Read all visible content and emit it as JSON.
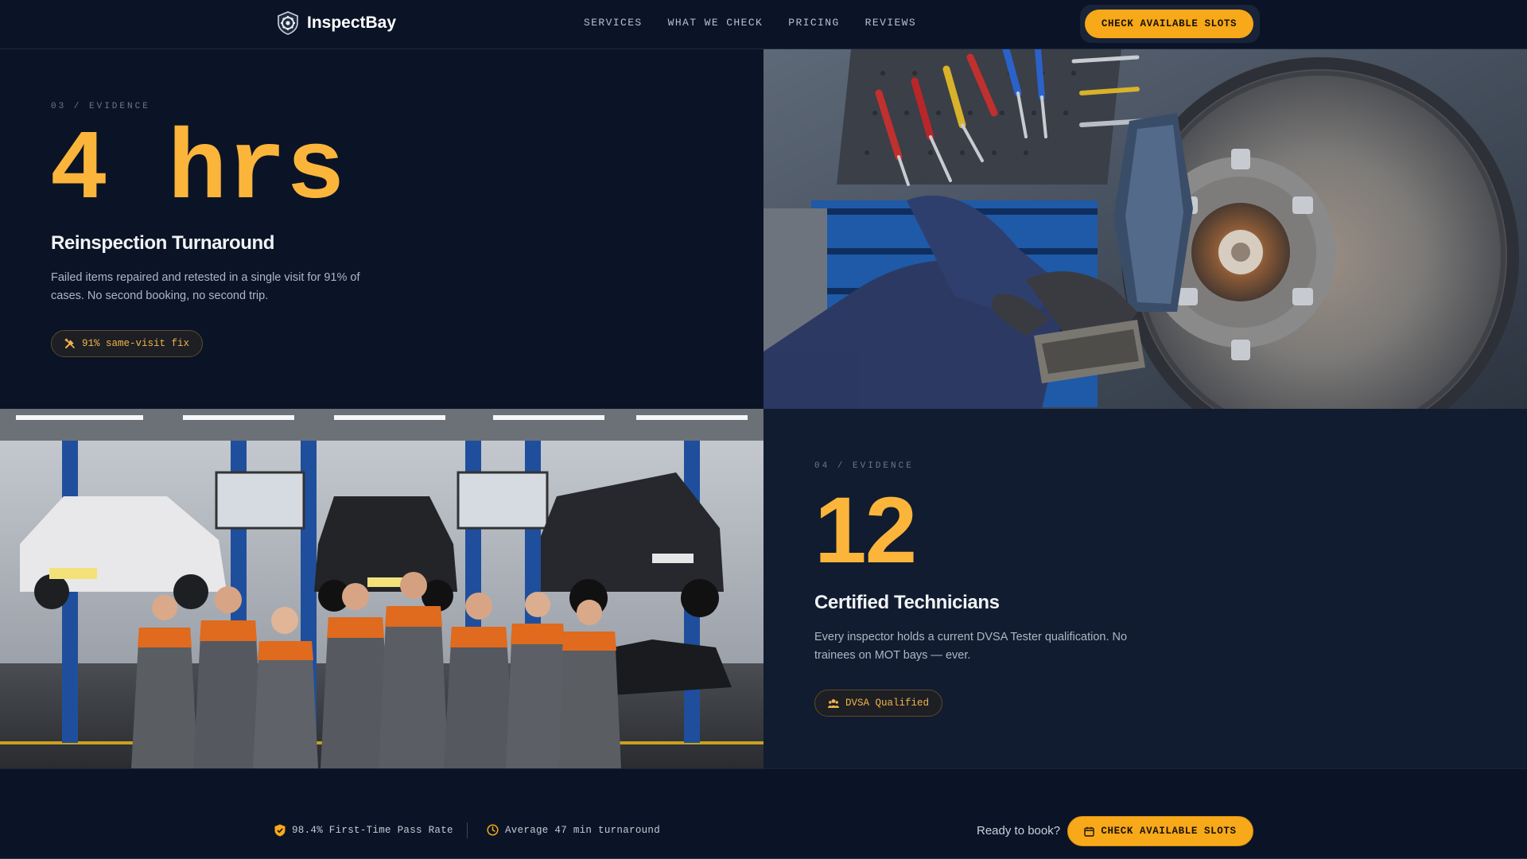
{
  "header": {
    "brand_name": "InspectBay",
    "logo_icon": "shield-gear-icon",
    "nav": [
      {
        "label": "SERVICES"
      },
      {
        "label": "WHAT WE CHECK"
      },
      {
        "label": "PRICING"
      },
      {
        "label": "REVIEWS"
      }
    ],
    "cta_label": "CHECK AVAILABLE SLOTS"
  },
  "colors": {
    "accent": "#f7a919",
    "number": "#fbb53a",
    "background": "#0b1426",
    "panel_alt": "#111c30"
  },
  "evidence": [
    {
      "eyebrow": "03 / EVIDENCE",
      "number": "4 hrs",
      "title": "Reinspection Turnaround",
      "body": "Failed items repaired and retested in a single visit for 91% of cases. No second booking, no second trip.",
      "pill_icon": "wrench-screwdriver-icon",
      "pill_label": "91% same-visit fix",
      "image": "brake-disc-repair-photo"
    },
    {
      "eyebrow": "04 / EVIDENCE",
      "number": "12",
      "title": "Certified Technicians",
      "body": "Every inspector holds a current DVSA Tester qualification. No trainees on MOT bays — ever.",
      "pill_icon": "team-icon",
      "pill_label": "DVSA Qualified",
      "image": "technician-team-photo"
    }
  ],
  "footer": {
    "stats": [
      {
        "icon": "shield-check-icon",
        "label": "98.4% First-Time Pass Rate"
      },
      {
        "icon": "clock-icon",
        "label": "Average 47 min turnaround"
      }
    ],
    "ready_text": "Ready to book?",
    "cta_icon": "calendar-icon",
    "cta_label": "CHECK AVAILABLE SLOTS"
  }
}
